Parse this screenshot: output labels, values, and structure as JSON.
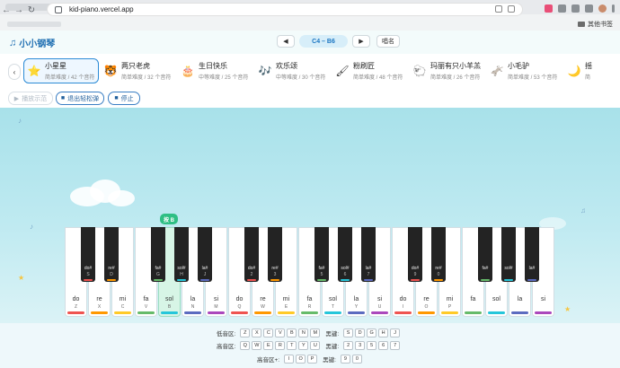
{
  "browser": {
    "url": "kid-piano.vercel.app",
    "bookmarks_other": "其他书签"
  },
  "header": {
    "title": "小小钢琴",
    "prev_label": "◀",
    "range": "C4 – B6",
    "next_label": "▶",
    "rollcall": "唱名"
  },
  "songs": [
    {
      "icon": "⭐",
      "icon_name": "star-icon",
      "name": "小星星",
      "meta": "简单难度 / 42 个音符"
    },
    {
      "icon": "🐯",
      "icon_name": "tiger-icon",
      "name": "两只老虎",
      "meta": "简单难度 / 32 个音符"
    },
    {
      "icon": "🎂",
      "icon_name": "cake-icon",
      "name": "生日快乐",
      "meta": "中等难度 / 25 个音符"
    },
    {
      "icon": "🎶",
      "icon_name": "music-notes-icon",
      "name": "欢乐颂",
      "meta": "中等难度 / 30 个音符"
    },
    {
      "icon": "🖌",
      "icon_name": "paintbrush-icon",
      "name": "粉刷匠",
      "meta": "简单难度 / 48 个音符"
    },
    {
      "icon": "🐑",
      "icon_name": "sheep-icon",
      "name": "玛丽有只小羊羔",
      "meta": "简单难度 / 26 个音符"
    },
    {
      "icon": "🫏",
      "icon_name": "donkey-icon",
      "name": "小毛驴",
      "meta": "简单难度 / 53 个音符"
    },
    {
      "icon": "🌙",
      "icon_name": "moon-icon",
      "name": "摇",
      "meta": "简"
    }
  ],
  "controls": {
    "demo": "播放示范",
    "exit_easy": "退出轻松弹",
    "stop": "停止"
  },
  "press_hint": "按 B",
  "white_keys": [
    {
      "note": "do",
      "key": "Z",
      "color": "#ef5350"
    },
    {
      "note": "re",
      "key": "X",
      "color": "#ff9800"
    },
    {
      "note": "mi",
      "key": "C",
      "color": "#ffca28"
    },
    {
      "note": "fa",
      "key": "V",
      "color": "#66bb6a"
    },
    {
      "note": "sol",
      "key": "B",
      "color": "#26c6da"
    },
    {
      "note": "la",
      "key": "N",
      "color": "#5c6bc0"
    },
    {
      "note": "si",
      "key": "M",
      "color": "#ab47bc"
    },
    {
      "note": "do",
      "key": "Q",
      "color": "#ef5350"
    },
    {
      "note": "re",
      "key": "W",
      "color": "#ff9800"
    },
    {
      "note": "mi",
      "key": "E",
      "color": "#ffca28"
    },
    {
      "note": "fa",
      "key": "R",
      "color": "#66bb6a"
    },
    {
      "note": "sol",
      "key": "T",
      "color": "#26c6da"
    },
    {
      "note": "la",
      "key": "Y",
      "color": "#5c6bc0"
    },
    {
      "note": "si",
      "key": "U",
      "color": "#ab47bc"
    },
    {
      "note": "do",
      "key": "I",
      "color": "#ef5350"
    },
    {
      "note": "re",
      "key": "O",
      "color": "#ff9800"
    },
    {
      "note": "mi",
      "key": "P",
      "color": "#ffca28"
    },
    {
      "note": "fa",
      "key": "",
      "color": "#66bb6a"
    },
    {
      "note": "sol",
      "key": "",
      "color": "#26c6da"
    },
    {
      "note": "la",
      "key": "",
      "color": "#5c6bc0"
    },
    {
      "note": "si",
      "key": "",
      "color": "#ab47bc"
    }
  ],
  "black_keys": [
    {
      "note": "do#",
      "key": "S",
      "color": "#ef5350"
    },
    {
      "note": "re#",
      "key": "D",
      "color": "#ff9800"
    },
    {
      "note": "fa#",
      "key": "G",
      "color": "#66bb6a"
    },
    {
      "note": "sol#",
      "key": "H",
      "color": "#26c6da"
    },
    {
      "note": "la#",
      "key": "J",
      "color": "#5c6bc0"
    },
    {
      "note": "do#",
      "key": "2",
      "color": "#ef5350"
    },
    {
      "note": "re#",
      "key": "3",
      "color": "#ff9800"
    },
    {
      "note": "fa#",
      "key": "5",
      "color": "#66bb6a"
    },
    {
      "note": "sol#",
      "key": "6",
      "color": "#26c6da"
    },
    {
      "note": "la#",
      "key": "7",
      "color": "#5c6bc0"
    },
    {
      "note": "do#",
      "key": "9",
      "color": "#ef5350"
    },
    {
      "note": "re#",
      "key": "0",
      "color": "#ff9800"
    },
    {
      "note": "fa#",
      "key": "",
      "color": "#66bb6a"
    },
    {
      "note": "sol#",
      "key": "",
      "color": "#26c6da"
    },
    {
      "note": "la#",
      "key": "",
      "color": "#5c6bc0"
    }
  ],
  "legend": {
    "low_label": "低音区:",
    "low_keys": [
      "Z",
      "X",
      "C",
      "V",
      "B",
      "N",
      "M"
    ],
    "low_black_label": "黑键:",
    "low_black_keys": [
      "S",
      "D",
      "G",
      "H",
      "J"
    ],
    "high_label": "高音区:",
    "high_keys": [
      "Q",
      "W",
      "E",
      "R",
      "T",
      "Y",
      "U"
    ],
    "high_black_label": "黑键:",
    "high_black_keys": [
      "2",
      "3",
      "5",
      "6",
      "7"
    ],
    "higher_label": "高音区+:",
    "higher_keys": [
      "I",
      "O",
      "P"
    ],
    "higher_black_label": "黑键:",
    "higher_black_keys": [
      "9",
      "0"
    ]
  }
}
